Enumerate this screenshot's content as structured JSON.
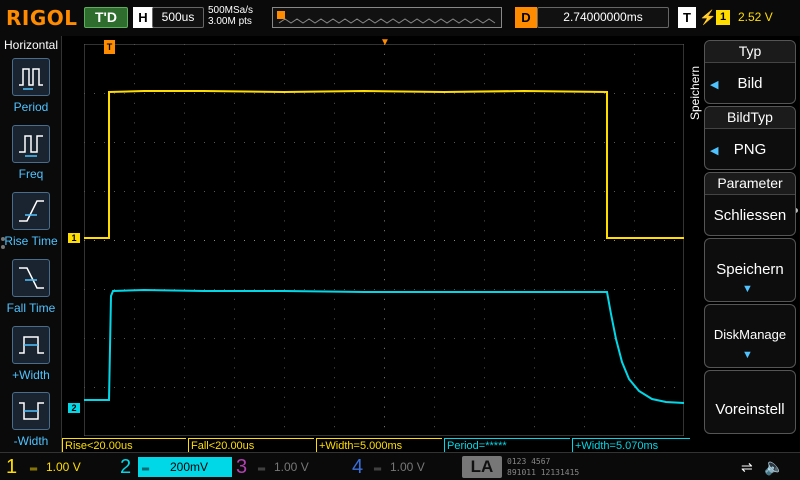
{
  "topbar": {
    "brand": "RIGOL",
    "run_state": "T'D",
    "h_letter": "H",
    "timebase": "500us",
    "sample_rate": "500MSa/s",
    "memory_depth": "3.00M pts",
    "d_letter": "D",
    "delay": "2.74000000ms",
    "t_letter": "T",
    "trigger_source": "1",
    "trigger_level": "2.52 V"
  },
  "leftpanel": {
    "title": "Horizontal",
    "items": [
      {
        "label": "Period",
        "icon": "period-icon"
      },
      {
        "label": "Freq",
        "icon": "freq-icon"
      },
      {
        "label": "Rise Time",
        "icon": "rise-time-icon"
      },
      {
        "label": "Fall Time",
        "icon": "fall-time-icon"
      },
      {
        "label": "+Width",
        "icon": "pos-width-icon"
      },
      {
        "label": "-Width",
        "icon": "neg-width-icon"
      }
    ]
  },
  "markers": {
    "trigger_pos": "T",
    "ch1": "1",
    "ch2": "2"
  },
  "measurements": [
    {
      "text": "Rise<20.00us",
      "color": "#ffdd00"
    },
    {
      "text": "Fall<20.00us",
      "color": "#ffdd00"
    },
    {
      "text": "+Width=5.000ms",
      "color": "#ffdd00"
    },
    {
      "text": "Period=*****",
      "color": "#00d8e8"
    },
    {
      "text": "+Width=5.070ms",
      "color": "#00d8e8"
    }
  ],
  "rightpanel": {
    "vertical_title": "Speichern",
    "typ_title": "Typ",
    "typ_value": "Bild",
    "bildtyp_title": "BildTyp",
    "bildtyp_value": "PNG",
    "parameter_title": "Parameter",
    "parameter_value": "Schliessen",
    "speichern_label": "Speichern",
    "diskmanage_label": "DiskManage",
    "voreinstell_label": "Voreinstell"
  },
  "bottombar": {
    "channels": [
      {
        "num": "1",
        "scale": "1.00 V",
        "color": "#ffdd00",
        "active": true
      },
      {
        "num": "2",
        "scale": "200mV",
        "color": "#00d8e8",
        "active": true
      },
      {
        "num": "3",
        "scale": "1.00 V",
        "color": "#b040b0",
        "active": false
      },
      {
        "num": "4",
        "scale": "1.00 V",
        "color": "#3a6fd8",
        "active": false
      }
    ],
    "la_label": "LA",
    "la_bits_top": "0123 4567",
    "la_bits_bottom": "891011 12131415"
  },
  "colors": {
    "ch1": "#ffdd00",
    "ch2": "#00d8e8",
    "accent": "#ff8c00",
    "grid": "#555555"
  }
}
